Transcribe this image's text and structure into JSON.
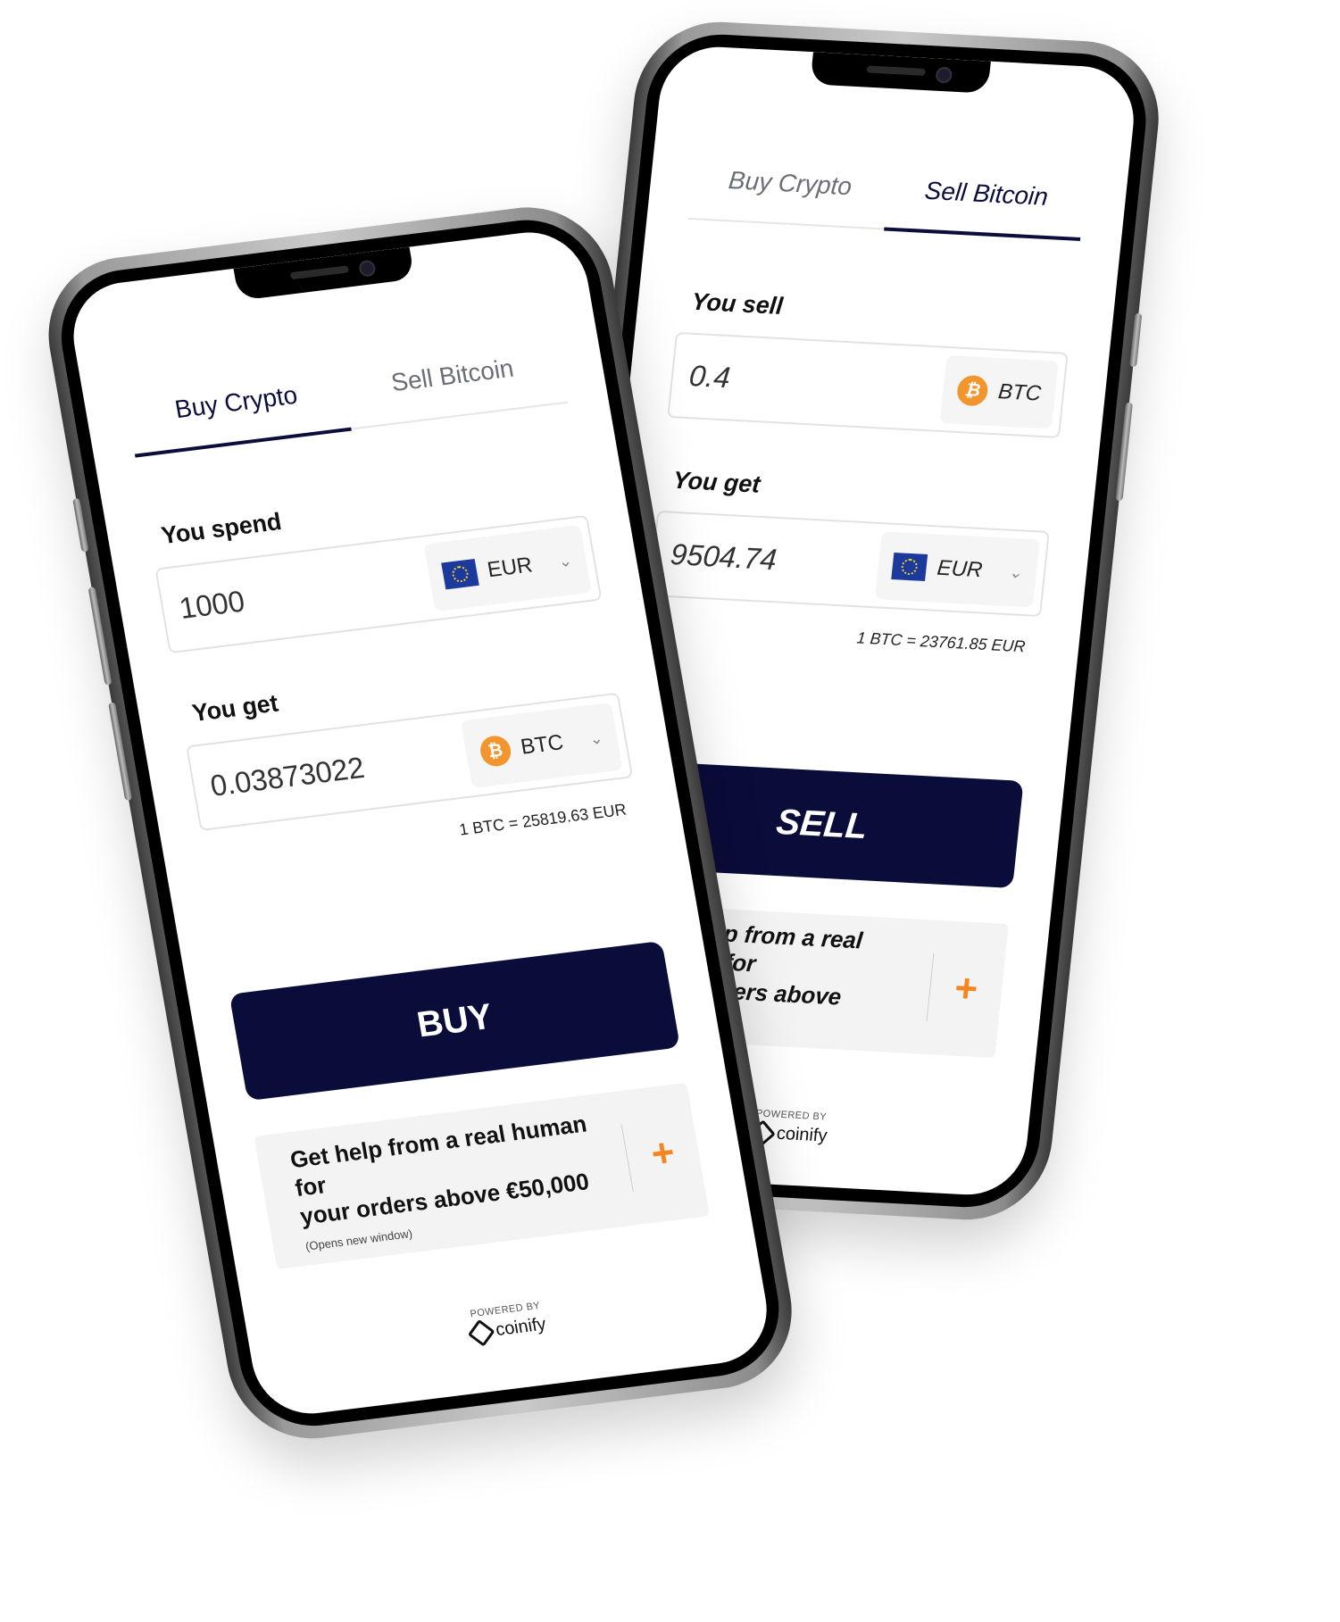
{
  "phones": {
    "buy": {
      "tabs": [
        {
          "label": "Buy Crypto",
          "active": true
        },
        {
          "label": "Sell Bitcoin",
          "active": false
        }
      ],
      "spend": {
        "label": "You spend",
        "value": "1000",
        "currency": "EUR",
        "currency_icon": "eu-flag-icon"
      },
      "get": {
        "label": "You get",
        "value": "0.03873022",
        "currency": "BTC",
        "currency_icon": "bitcoin-icon"
      },
      "rate": "1 BTC = 25819.63 EUR",
      "action_label": "BUY",
      "help": {
        "line1": "Get help from a real human for",
        "line2": "your orders above €50,000",
        "note": "(Opens new window)",
        "icon": "plus-icon"
      },
      "powered": {
        "label": "POWERED BY",
        "brand": "coinify"
      }
    },
    "sell": {
      "tabs": [
        {
          "label": "Buy Crypto",
          "active": false
        },
        {
          "label": "Sell Bitcoin",
          "active": true
        }
      ],
      "sell": {
        "label": "You sell",
        "value": "0.4",
        "currency": "BTC",
        "currency_icon": "bitcoin-icon"
      },
      "get": {
        "label": "You get",
        "value": "9504.74",
        "currency": "EUR",
        "currency_icon": "eu-flag-icon"
      },
      "rate": "1 BTC = 23761.85 EUR",
      "action_label": "SELL",
      "help": {
        "line1": "Get help from a real human for",
        "line2": "your orders above €50,000",
        "icon": "plus-icon"
      },
      "powered": {
        "label": "POWERED BY",
        "brand": "coinify"
      }
    }
  },
  "colors": {
    "brand_navy": "#0a0c3a",
    "accent_orange": "#f5861f",
    "btc_orange": "#f2952e"
  }
}
